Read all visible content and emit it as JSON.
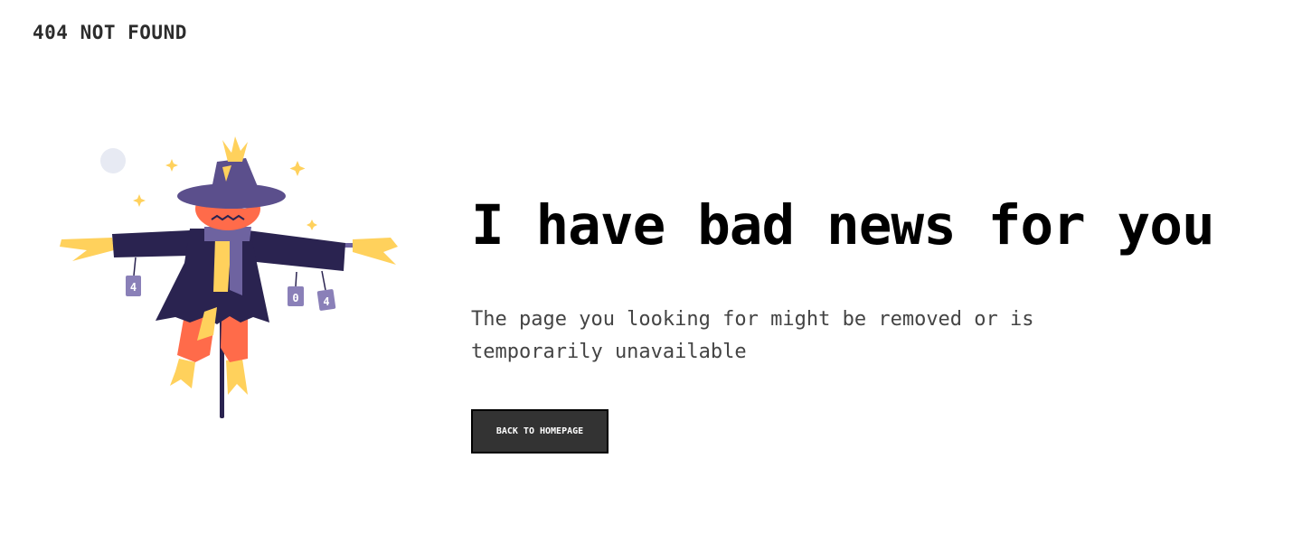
{
  "header": {
    "title": "404 NOT FOUND"
  },
  "main": {
    "headline": "I have bad news for you",
    "description": "The page you looking for might be removed or is temporarily unavailable",
    "button_label": "BACK TO HOMEPAGE"
  },
  "illustration": {
    "icon": "scarecrow-illustration",
    "can_labels": [
      "4",
      "0",
      "4"
    ]
  },
  "colors": {
    "background": "#ffffff",
    "text": "#000000",
    "button_bg": "#333333",
    "hat": "#5b4f8c",
    "coat": "#2a2350",
    "pumpkin": "#ff6b4a",
    "straw": "#ffd15c",
    "moon": "#e7eaf3"
  }
}
